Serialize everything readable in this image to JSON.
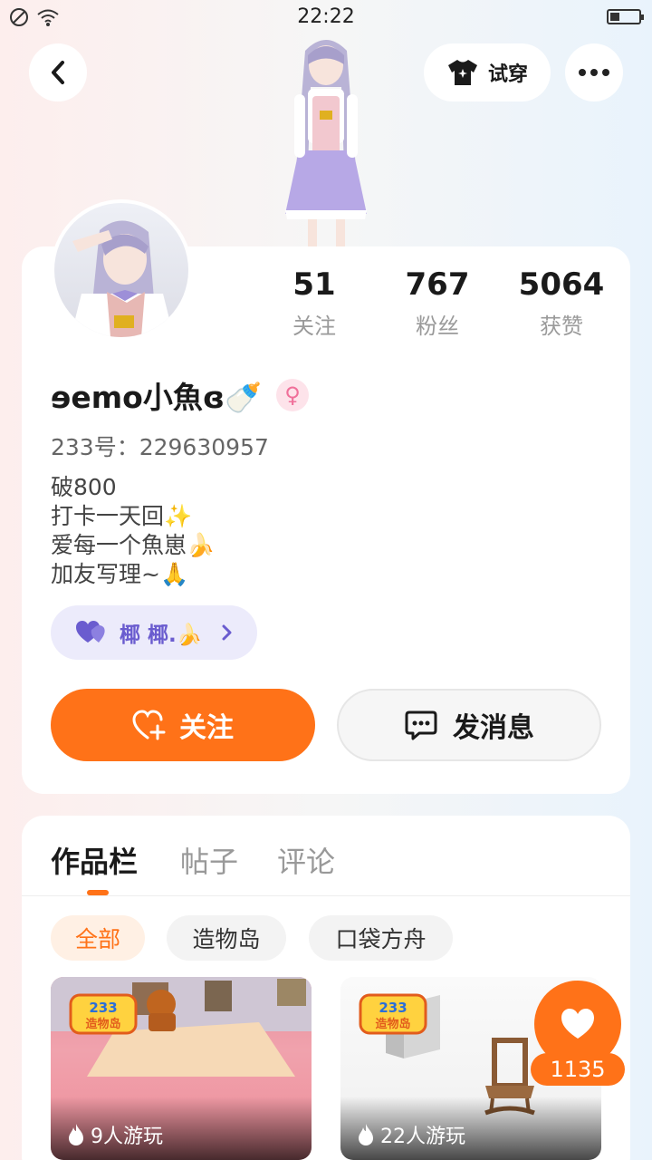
{
  "status_bar": {
    "time": "22:22"
  },
  "header": {
    "tryon_label": "试穿"
  },
  "profile": {
    "stats": [
      {
        "value": "51",
        "label": "关注"
      },
      {
        "value": "767",
        "label": "粉丝"
      },
      {
        "value": "5064",
        "label": "获赞"
      }
    ],
    "nickname": "ɘemo小魚ɞ🍼",
    "gender_symbol": "♀",
    "uid": "233号：229630957",
    "bio_lines": [
      "破800",
      "打卡一天回✨",
      "爱每一个魚崽🍌",
      "加友写理~🙏"
    ],
    "tag_label": "椰 椰.🍌",
    "follow_label": "关注",
    "message_label": "发消息"
  },
  "tabs": [
    "作品栏",
    "帖子",
    "评论"
  ],
  "filters": [
    "全部",
    "造物岛",
    "口袋方舟"
  ],
  "works": [
    {
      "plays": "9人游玩",
      "logo_text": "233 造物岛"
    },
    {
      "plays": "22人游玩",
      "logo_text": "233 造物岛"
    }
  ],
  "like_count": "1135",
  "colors": {
    "accent": "#ff7218",
    "tag_purple": "#6a5ccf",
    "female_pink": "#f0709a"
  }
}
